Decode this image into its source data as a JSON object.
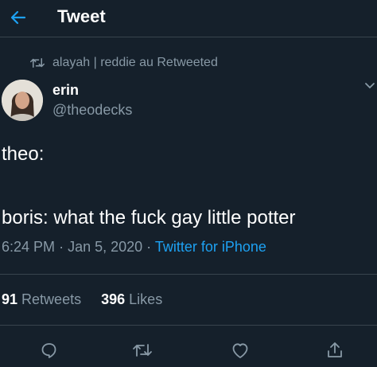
{
  "header": {
    "title": "Tweet",
    "back_icon": "arrow-left-icon"
  },
  "retweet_context": {
    "icon": "retweet-icon",
    "text": "alayah | reddie au Retweeted"
  },
  "author": {
    "display_name": "erin",
    "handle": "@theodecks"
  },
  "tweet": {
    "text": "theo:\n\nboris: what the fuck gay little potter",
    "time": "6:24 PM",
    "date": "Jan 5, 2020",
    "separator": "·",
    "source": "Twitter for iPhone"
  },
  "stats": {
    "retweets_count": "91",
    "retweets_label": "Retweets",
    "likes_count": "396",
    "likes_label": "Likes"
  },
  "actions": [
    "reply-icon",
    "retweet-icon",
    "like-icon",
    "share-icon"
  ],
  "colors": {
    "background": "#15202b",
    "accent": "#1da1f2",
    "secondary_text": "#8899a6",
    "divider": "#38444d"
  }
}
